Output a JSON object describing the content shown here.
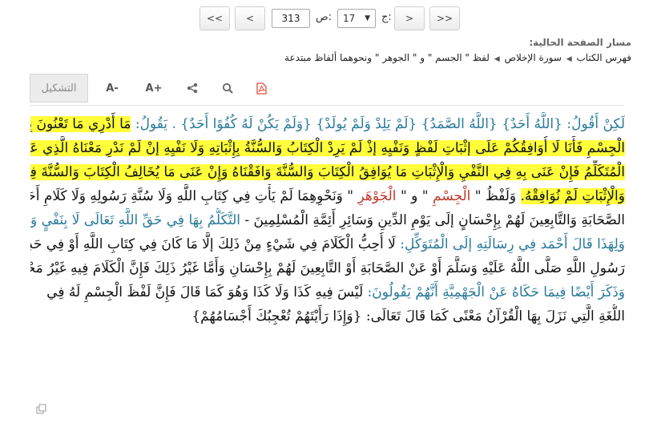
{
  "nav": {
    "first_label": "<<",
    "prev_label": "<",
    "next_label": ">",
    "last_label": ">>",
    "part_label": "ج:",
    "part_value": "17",
    "page_label": "ص:",
    "page_value": "313"
  },
  "breadcrumb": {
    "title": "مسار الصفحة الحالية:",
    "items": [
      "فهرس الكتاب",
      "سورة الإخلاص",
      "لفظ \" الجسم \" و \" الجوهر \" ونحوهما ألفاظ مبتدعة"
    ]
  },
  "toolbar": {
    "tashkeel_label": "التشكيل",
    "font_decrease_label": "A-",
    "font_increase_label": "A+"
  },
  "content": {
    "l1a": "لَكِنْ أَقُولُ: {اللَّهُ أَحَدٌ} {اللَّهُ الصَّمَدُ} {لَمْ يَلِدْ وَلَمْ يُولَدْ} {وَلَمْ يَكُنْ لَهُ كُفُوًا أَحَدٌ} . يَقُولُ:",
    "l1b": "مَا أَدْرِي مَا تَعْنُونَ بِلَفْظِ",
    "l2": "الْجِسْمِ فَأَنَا لَا أُوَافِقُكُمْ عَلَى إثْبَاتِ لَفْظٍ وَنَفْيِهِ إذْ لَمْ يَرِدْ الْكِتَابُ وَالسُّنَّةُ بِإِثْبَاتِهِ وَلَا نَفْيِهِ إنْ لَمْ نَدْرِ مَعْنَاهُ الَّذِي عَنَاهُ",
    "l3": "الْمُتَكَلِّمُ فَإِنْ عَنَى بِهِ فِي النَّفْيِ وَالْإِثْبَاتِ مَا يُوَافِقُ الْكِتَابَ وَالسُّنَّةَ وَافَقْنَاهُ وَإِنْ عَنَى مَا يُخَالِفُ الْكِتَابَ وَالسُّنَّةَ فِي النَّفْيِ",
    "l4a": "وَالْإِثْبَاتِ لَمْ نُوَافِقْهُ.",
    "l4b": "وَلَفْظُ \"",
    "l4c": "الْجِسْمِ",
    "l4d": "\" و \"",
    "l4e": "الْجَوْهَرِ",
    "l4f": "\" وَنَحْوِهِمَا لَمْ يَأْتِ فِي كِتَابِ اللَّهِ وَلَا سُنَّةِ رَسُولِهِ وَلَا كَلَامِ أَحَدٍ - مِنْ",
    "l5a": "الصَّحَابَةِ وَالتَّابِعِينَ لَهُمْ بِإِحْسَانٍ إلَى يَوْمِ الدِّينِ وَسَائِرِ أَئِمَّةِ الْمُسْلِمِينَ -",
    "l5b": "التَّكَلُّمُ بِهَا فِي حَقِّ اللَّهِ تَعَالَى لَا بِنَفْيٍ وَلَا إثْبَاتٍ",
    "l6a": "وَلِهَذَا قَالَ أَحْمَد فِي رِسَالَتِهِ إلَى الْمُتَوَكِّلِ:",
    "l6b": "لَا أُحِبُّ الْكَلَامَ فِي شَيْءٍ مِنْ ذَلِكَ إلَّا مَا كَانَ فِي كِتَابِ اللَّهِ أَوْ فِي حَدِيثٍ عَنْ",
    "l7a": "رَسُولِ اللَّهِ صَلَّى اللَّهُ عَلَيْهِ وَسَلَّمَ أَوْ عَنْ الصَّحَابَةِ أَوْ التَّابِعِينَ لَهُمْ بِإِحْسَانِ وَأَمَّا غَيْرُ ذَلِكَ فَإِنَّ الْكَلَامَ فِيهِ غَيْرُ مَحْمُودٍ",
    "l7b": ".",
    "l8a": "وَذَكَرَ أَيْضًا فِيمَا حَكَاهُ عَنْ الْجَهْمِيَّةِ أَنَّهُمْ يَقُولُونَ:",
    "l8b": "لَيْسَ فِيهِ كَذَا وَلَا كَذَا وَهُوَ كَمَا قَالَ فَإِنَّ لَفْظَ الْجِسْمِ لَهُ فِي",
    "l9": "اللُّغَةِ الَّتِي نَزَلَ بِهَا الْقُرْآنُ مَعْنًى كَمَا قَالَ تَعَالَى: {وَإِذَا رَأَيْتَهُمْ تُعْجِبُكَ أَجْسَامُهُمْ}"
  },
  "colors": {
    "highlight": "#ffff3a",
    "blue_text": "#2a7a9a",
    "red_text": "#c0392b",
    "pdf_icon": "#e74c3c"
  }
}
